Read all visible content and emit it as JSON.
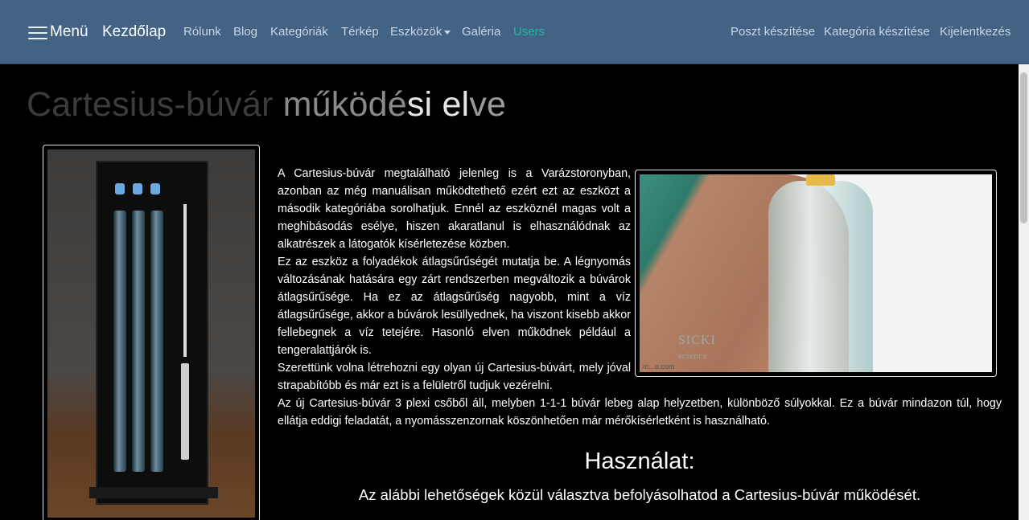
{
  "nav": {
    "menu_label": "Menü",
    "brand": "Kezdőlap",
    "links": [
      "Rólunk",
      "Blog",
      "Kategóriák",
      "Térkép",
      "Eszközök",
      "Galéria",
      "Users"
    ],
    "right_links": [
      "Poszt készítése",
      "Kategória készítése",
      "Kijelentkezés"
    ],
    "active_color": "#19bc9c",
    "bar_color": "#436384"
  },
  "title": {
    "part1": "Cartesius-búvár",
    "part2": "működé",
    "part3": "si el",
    "part4": "ve"
  },
  "paragraphs": [
    "A Cartesius-búvár megtalálható jelenleg is a Varázstoronyban, azonban az még manuálisan működtethető ezért ezt az eszközt a második kategóriába sorolhatjuk. Ennél az eszköznél magas volt a meghibásodás esélye, hiszen akaratlanul is elhasználódnak az alkatrészek a látogatók kísérletezése közben.",
    "Ez az eszköz a folyadékok átlagsűrűségét mutatja be. A légnyomás változásának hatására egy zárt rendszerben megváltozik a búvárok átlagsűrűsége. Ha ez az átlagsűrűség nagyobb, mint a víz átlagsűrűsége, akkor a búvárok lesüllyednek, ha viszont kisebb akkor fellebegnek a víz tetejére. Hasonló elven működnek például a tengeralattjárók is.",
    "Szerettünk volna létrehozni egy olyan új Cartesius-búvárt, mely jóval strapabítóbb és már ezt is a felületről tudjuk vezérelni.",
    "Az új Cartesius-búvár 3 plexi csőből áll, melyben 1-1-1 búvár lebeg alap helyzetben, különböző súlyokkal. Ez a búvár mindazon túl, hogy ellátja eddigi feladatát, a nyomásszenzornak köszönhetően már mérőkísérletként is használható."
  ],
  "image_right": {
    "watermark": "SICKI",
    "watermark_sub": "science",
    "url_text": "m...o.com"
  },
  "usage": {
    "title": "Használat:",
    "subtitle": "Az alábbi lehetőségek közül választva befolyásolhatod a Cartesius-búvár működését."
  }
}
